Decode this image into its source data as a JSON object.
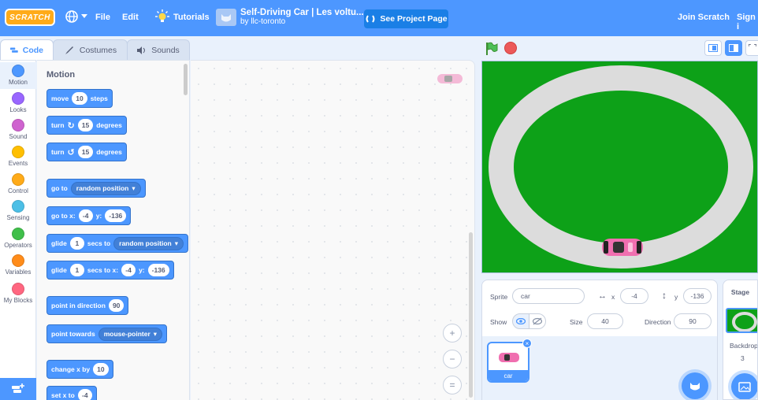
{
  "menubar": {
    "logo": "SCRATCH",
    "file": "File",
    "edit": "Edit",
    "tutorials": "Tutorials",
    "project_title": "Self-Driving Car | Les voltu...",
    "project_author": "by llc-toronto",
    "see_project": "See Project Page",
    "join": "Join Scratch",
    "sign_in": "Sign i"
  },
  "tabs": {
    "code": "Code",
    "costumes": "Costumes",
    "sounds": "Sounds"
  },
  "categories": [
    {
      "label": "Motion",
      "color": "#4c97ff"
    },
    {
      "label": "Looks",
      "color": "#9966ff"
    },
    {
      "label": "Sound",
      "color": "#cf63cf"
    },
    {
      "label": "Events",
      "color": "#ffbf00"
    },
    {
      "label": "Control",
      "color": "#ffab19"
    },
    {
      "label": "Sensing",
      "color": "#4cbfe6"
    },
    {
      "label": "Operators",
      "color": "#40bf4a"
    },
    {
      "label": "Variables",
      "color": "#ff8c1a"
    },
    {
      "label": "My Blocks",
      "color": "#ff6680"
    }
  ],
  "palette": {
    "title": "Motion",
    "move": {
      "a": "move",
      "n": "10",
      "b": "steps"
    },
    "turn_right": {
      "a": "turn",
      "n": "15",
      "b": "degrees"
    },
    "turn_left": {
      "a": "turn",
      "n": "15",
      "b": "degrees"
    },
    "goto": {
      "a": "go to",
      "dd": "random position"
    },
    "gotoxy": {
      "a": "go to x:",
      "x": "-4",
      "yl": "y:",
      "y": "-136"
    },
    "glide_random": {
      "a": "glide",
      "n": "1",
      "b": "secs to",
      "dd": "random position"
    },
    "glide_xy": {
      "a": "glide",
      "n": "1",
      "b": "secs to x:",
      "x": "-4",
      "yl": "y:",
      "y": "-136"
    },
    "point_dir": {
      "a": "point in direction",
      "n": "90"
    },
    "point_towards": {
      "a": "point towards",
      "dd": "mouse-pointer"
    },
    "change_x": {
      "a": "change x by",
      "n": "10"
    },
    "set_x": {
      "a": "set x to",
      "n": "-4"
    }
  },
  "zoom": {
    "in": "+",
    "out": "−",
    "reset": "="
  },
  "sprite_info": {
    "sprite_label": "Sprite",
    "sprite_name": "car",
    "x_label": "x",
    "x": "-4",
    "y_label": "y",
    "y": "-136",
    "show_label": "Show",
    "size_label": "Size",
    "size": "40",
    "direction_label": "Direction",
    "direction": "90"
  },
  "sprite_list": [
    {
      "name": "car"
    }
  ],
  "stage_pane": {
    "title": "Stage",
    "backdrops_label": "Backdrops",
    "backdrops_count": "3"
  },
  "colors": {
    "accent": "#4d97ff",
    "stage_green": "#0da118",
    "track": "#dcdcdc",
    "car": "#f06fb0"
  }
}
